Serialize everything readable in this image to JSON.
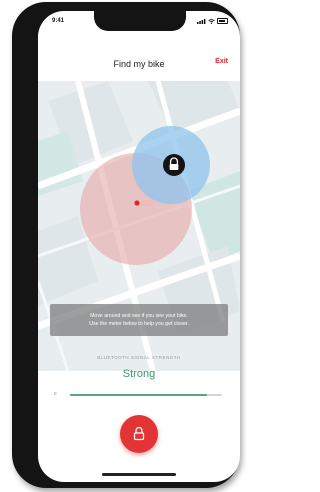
{
  "status_bar": {
    "time": "9:41",
    "signal_icon": "signal-bars-icon",
    "wifi_icon": "wifi-icon",
    "battery_icon": "battery-icon"
  },
  "header": {
    "title": "Find my bike",
    "exit_label": "Exit"
  },
  "map": {
    "bike_marker_icon": "bike-lock-icon",
    "user_marker_icon": "user-location-icon"
  },
  "overlay": {
    "line1": "Move around and see if you see your bike.",
    "line2": "Use the meter below to help you get closer."
  },
  "signal": {
    "label": "BLUETOOTH SIGNAL STRENGTH",
    "value": "Strong",
    "min_label": "0",
    "level": 0.9
  },
  "action": {
    "icon": "lock-icon"
  },
  "colors": {
    "accent_red": "#e23434",
    "signal_green": "#3a9a63",
    "map_bike_circle": "#8fc3ec",
    "map_user_circle": "#e6a0a0"
  }
}
